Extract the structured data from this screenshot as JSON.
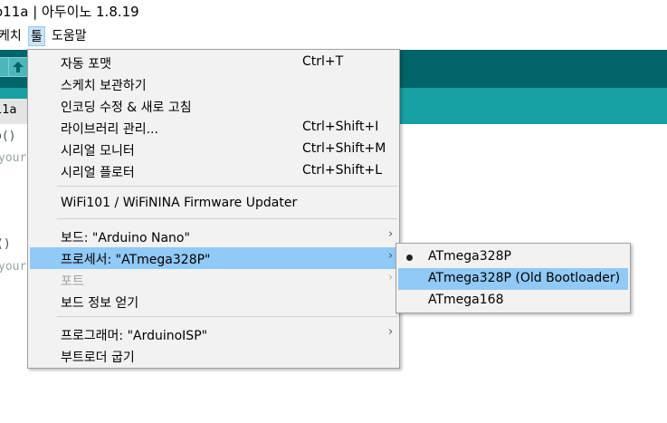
{
  "window": {
    "title": "o11a | 아두이노 1.8.19"
  },
  "menubar": {
    "items": [
      "케치",
      "툴",
      "도움말"
    ]
  },
  "tab": {
    "name": "11a"
  },
  "code": {
    "line1": "p()",
    "line2": "your",
    "line3": "()",
    "line4": "your"
  },
  "tools_menu": {
    "auto_format": {
      "label": "자동 포맷",
      "shortcut": "Ctrl+T"
    },
    "archive_sketch": {
      "label": "스케치 보관하기"
    },
    "fix_encoding": {
      "label": "인코딩 수정 & 새로 고침"
    },
    "manage_libraries": {
      "label": "라이브러리 관리...",
      "shortcut": "Ctrl+Shift+I"
    },
    "serial_monitor": {
      "label": "시리얼 모니터",
      "shortcut": "Ctrl+Shift+M"
    },
    "serial_plotter": {
      "label": "시리얼 플로터",
      "shortcut": "Ctrl+Shift+L"
    },
    "wifi_updater": {
      "label": "WiFi101 / WiFiNINA Firmware Updater"
    },
    "board": {
      "label": "보드: \"Arduino Nano\""
    },
    "processor": {
      "label": "프로세서: \"ATmega328P\""
    },
    "port": {
      "label": "포트"
    },
    "board_info": {
      "label": "보드 정보 얻기"
    },
    "programmer": {
      "label": "프로그래머: \"ArduinoISP\""
    },
    "burn_bootloader": {
      "label": "부트로더 굽기"
    }
  },
  "processor_submenu": {
    "items": [
      "ATmega328P",
      "ATmega328P (Old Bootloader)",
      "ATmega168"
    ],
    "selected": "ATmega328P",
    "highlighted": "ATmega328P (Old Bootloader)"
  },
  "colors": {
    "toolbar": "#006468",
    "tabbar": "#17a1a5",
    "highlight": "#91c9f7"
  }
}
